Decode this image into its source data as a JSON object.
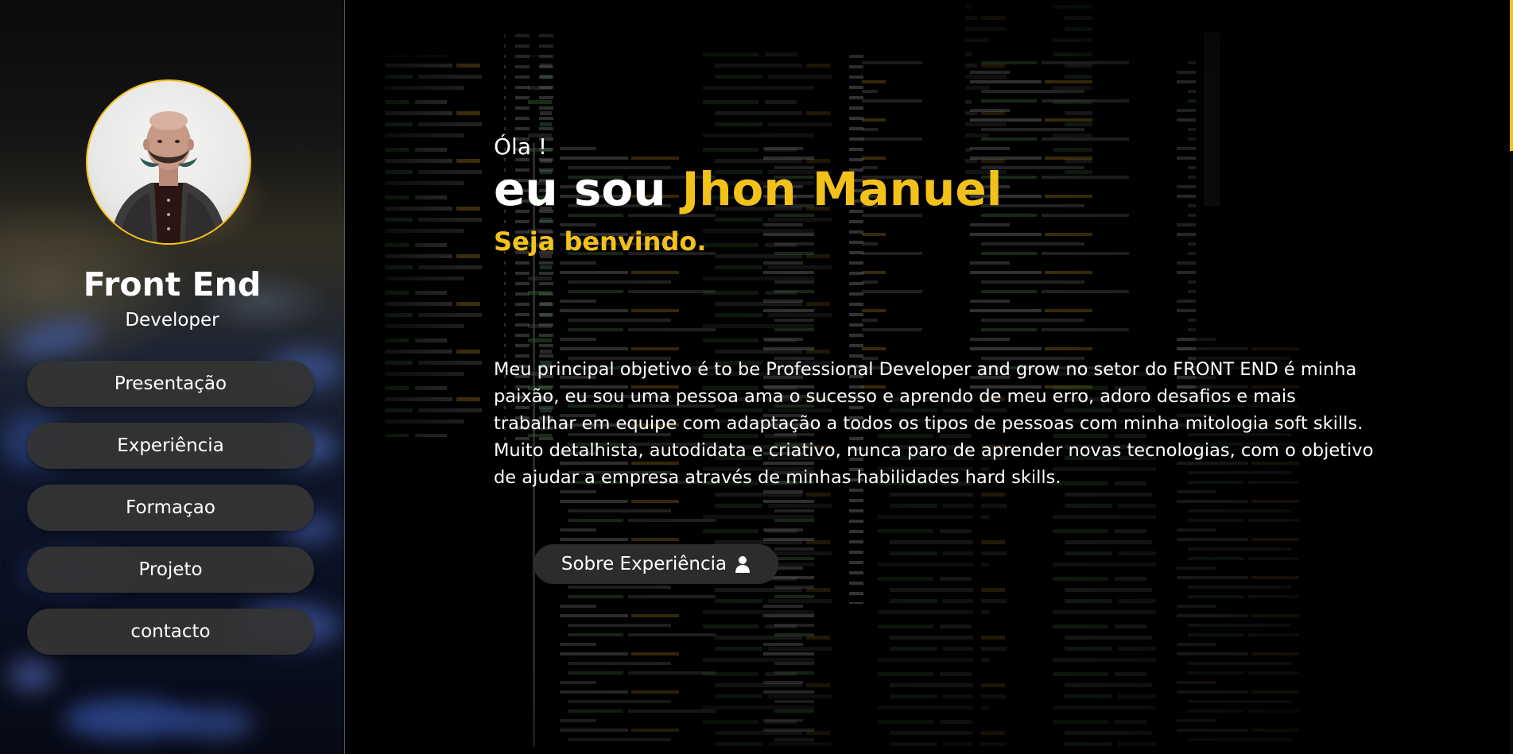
{
  "sidebar": {
    "profile_alt": "Jhon Manuel",
    "title": "Front End",
    "subtitle": "Developer",
    "nav": [
      {
        "label": "Presentação"
      },
      {
        "label": "Experiência"
      },
      {
        "label": "Formaçao"
      },
      {
        "label": "Projeto"
      },
      {
        "label": "contacto"
      }
    ]
  },
  "hero": {
    "greeting": "Óla !",
    "headline_prefix": "eu sou",
    "name": "Jhon Manuel",
    "welcome": "Seja benvindo.",
    "bio": "Meu principal objetivo é to be Professional Developer and grow no setor do FRONT END é minha paixão, eu sou uma pessoa ama o sucesso e aprendo de meu erro, adoro desafios e mais trabalhar em equipe com adaptação a todos os tipos de pessoas com minha mitologia soft skills. Muito detalhista, autodidata e criativo, nunca paro de aprender novas tecnologias, com o objetivo de ajudar a empresa através de minhas habilidades hard skills.",
    "cta_label": "Sobre Experiência",
    "cta_icon": "user-icon"
  },
  "colors": {
    "accent": "#f2c21b",
    "button_bg": "#343434",
    "background": "#000000"
  }
}
